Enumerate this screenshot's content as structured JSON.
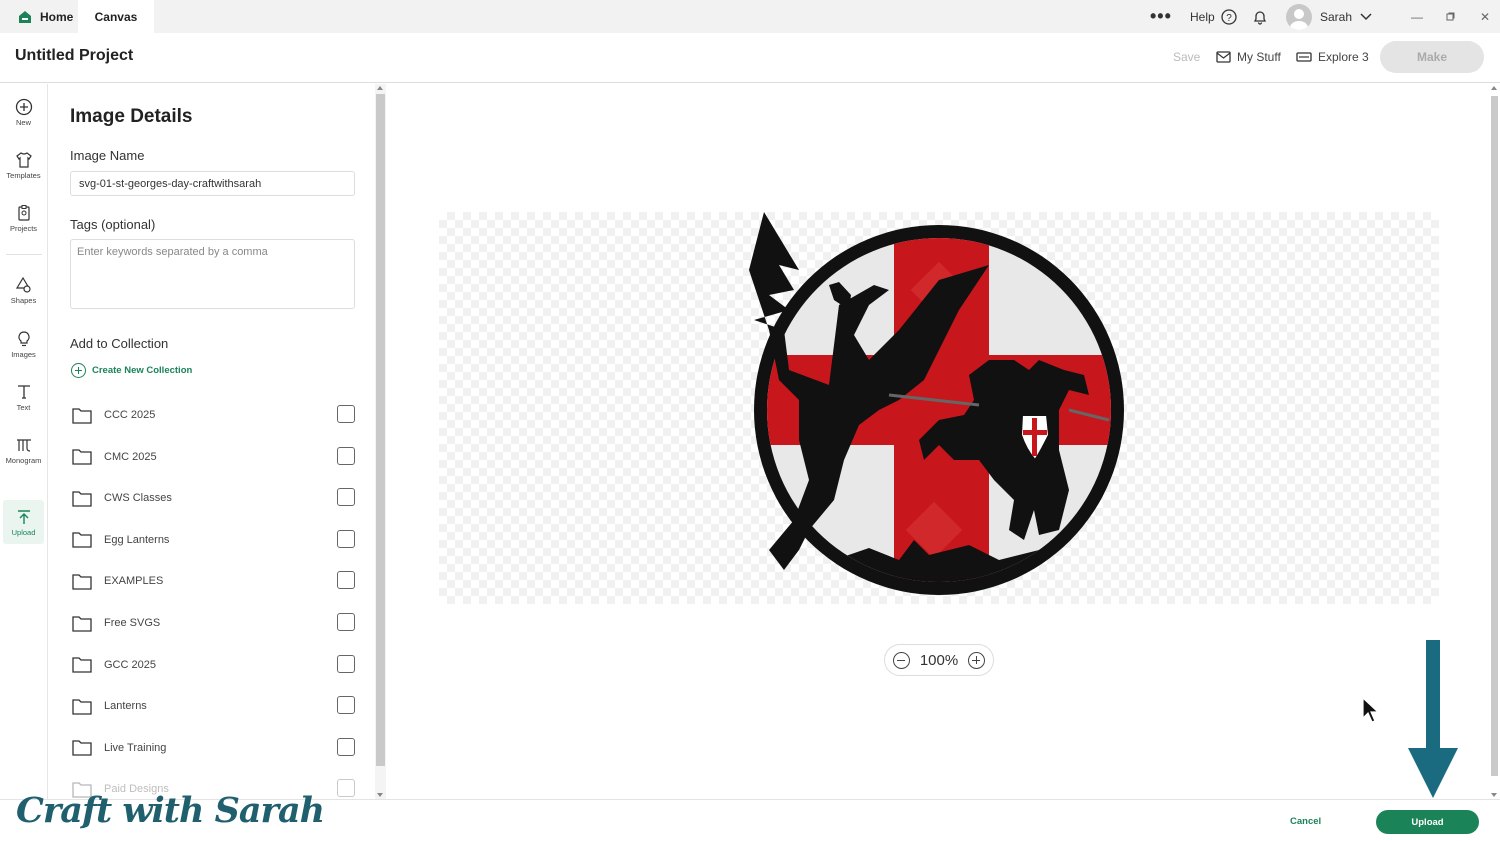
{
  "titlebar": {
    "tabs": [
      {
        "label": "Home"
      },
      {
        "label": "Canvas"
      }
    ],
    "help_label": "Help",
    "user_name": "Sarah"
  },
  "header": {
    "project_title": "Untitled Project",
    "save_label": "Save",
    "mystuff_label": "My Stuff",
    "machine_label": "Explore 3",
    "make_label": "Make"
  },
  "rail": {
    "items": [
      {
        "label": "New",
        "icon": "plus-circle-icon"
      },
      {
        "label": "Templates",
        "icon": "shirt-icon"
      },
      {
        "label": "Projects",
        "icon": "clipboard-icon"
      },
      {
        "label": "Shapes",
        "icon": "shapes-icon"
      },
      {
        "label": "Images",
        "icon": "lightbulb-icon"
      },
      {
        "label": "Text",
        "icon": "text-icon"
      },
      {
        "label": "Monogram",
        "icon": "monogram-icon"
      },
      {
        "label": "Upload",
        "icon": "upload-icon",
        "active": true
      }
    ]
  },
  "panel": {
    "title": "Image Details",
    "image_name_label": "Image Name",
    "image_name_value": "svg-01-st-georges-day-craftwithsarah",
    "tags_label": "Tags (optional)",
    "tags_placeholder": "Enter keywords separated by a comma",
    "collection_label": "Add to Collection",
    "create_collection_label": "Create New Collection",
    "collections": [
      {
        "name": "CCC 2025",
        "checked": false
      },
      {
        "name": "CMC 2025",
        "checked": false
      },
      {
        "name": "CWS Classes",
        "checked": false
      },
      {
        "name": "Egg Lanterns",
        "checked": false
      },
      {
        "name": "EXAMPLES",
        "checked": false
      },
      {
        "name": "Free SVGS",
        "checked": false
      },
      {
        "name": "GCC 2025",
        "checked": false
      },
      {
        "name": "Lanterns",
        "checked": false
      },
      {
        "name": "Live Training",
        "checked": false
      },
      {
        "name": "Paid Designs",
        "checked": false
      }
    ]
  },
  "canvas": {
    "zoom_label": "100%"
  },
  "footer": {
    "cancel_label": "Cancel",
    "upload_label": "Upload"
  },
  "watermark": "Craft with Sarah",
  "colors": {
    "accent": "#1b8358",
    "flag_red": "#c8161d",
    "arrow": "#1a6b80"
  }
}
